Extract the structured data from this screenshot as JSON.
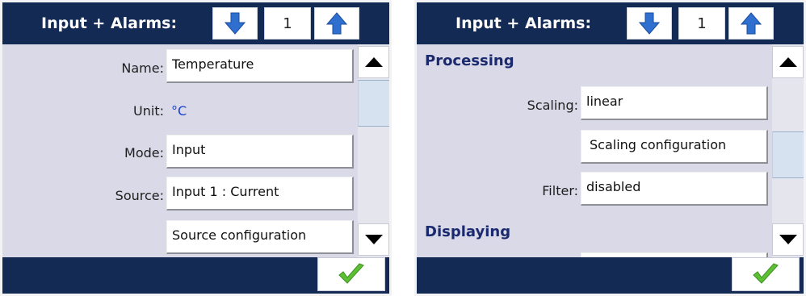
{
  "left": {
    "title": "Input + Alarms:",
    "page_number": "1",
    "fields": [
      {
        "label": "Name:",
        "value": "Temperature"
      },
      {
        "label": "Mode:",
        "value": "Input"
      },
      {
        "label": "Source:",
        "value": "Input 1 : Current"
      }
    ],
    "unit_label": "Unit:",
    "unit_value": "°C",
    "source_config_button": "Source configuration",
    "scroll_position": 0.15
  },
  "right": {
    "title": "Input + Alarms:",
    "page_number": "1",
    "section_processing": "Processing",
    "scaling_label": "Scaling:",
    "scaling_value": "linear",
    "scaling_config_button": "Scaling configuration",
    "filter_label": "Filter:",
    "filter_value": "disabled",
    "section_displaying": "Displaying",
    "scroll_position": 0.55
  },
  "colors": {
    "bar": "#132a55",
    "content_bg": "#d9d9e8",
    "arrow_blue": "#2f6fd0",
    "check_green": "#5cc033"
  },
  "icons": [
    "arrow-down-icon",
    "arrow-up-icon",
    "scroll-up-icon",
    "scroll-down-icon",
    "checkmark-icon"
  ]
}
